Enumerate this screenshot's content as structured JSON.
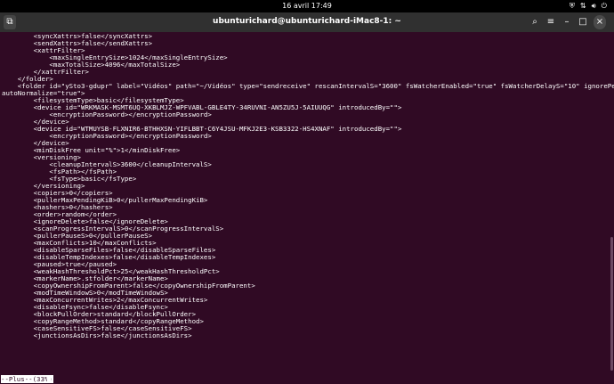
{
  "topbar": {
    "clock": "16 avril  17:49",
    "icons": [
      "shield-icon",
      "network-icon",
      "volume-icon",
      "power-icon"
    ]
  },
  "window": {
    "title": "ubunturichard@ubunturichard-iMac8-1: ~",
    "buttons": [
      "new-tab-icon",
      "search-icon",
      "menu-icon",
      "minimize-icon",
      "maximize-icon",
      "close-icon"
    ]
  },
  "terminal": {
    "lines": [
      "        <syncXattrs>false</syncXattrs>",
      "        <sendXattrs>false</sendXattrs>",
      "        <xattrFilter>",
      "            <maxSingleEntrySize>1024</maxSingleEntrySize>",
      "            <maxTotalSize>4096</maxTotalSize>",
      "        </xattrFilter>",
      "    </folder>",
      "    <folder id=\"ySto3-gdupr\" label=\"Vidéos\" path=\"~/Vidéos\" type=\"sendreceive\" rescanIntervalS=\"3600\" fsWatcherEnabled=\"true\" fsWatcherDelayS=\"10\" ignorePerms=\"false\"",
      "autoNormalize=\"true\">",
      "        <filesystemType>basic</filesystemType>",
      "        <device id=\"WRKMASK-MSMT6UQ-XKBLMJZ-WPFVABL-GBLE4TY-34RUVNI-AN5ZU5J-5AIUUQG\" introducedBy=\"\">",
      "            <encryptionPassword></encryptionPassword>",
      "        </device>",
      "        <device id=\"WTMUYSB-FLXNIR6-BTHHXSN-YIFLBBT-C6Y4JSU-MFKJ2E3-KSB3322-HS4XNAF\" introducedBy=\"\">",
      "            <encryptionPassword></encryptionPassword>",
      "        </device>",
      "        <minDiskFree unit=\"%\">1</minDiskFree>",
      "        <versioning>",
      "            <cleanupIntervalS>3600</cleanupIntervalS>",
      "            <fsPath></fsPath>",
      "            <fsType>basic</fsType>",
      "        </versioning>",
      "        <copiers>0</copiers>",
      "        <pullerMaxPendingKiB>0</pullerMaxPendingKiB>",
      "        <hashers>0</hashers>",
      "        <order>random</order>",
      "        <ignoreDelete>false</ignoreDelete>",
      "        <scanProgressIntervalS>0</scanProgressIntervalS>",
      "        <pullerPauseS>0</pullerPauseS>",
      "        <maxConflicts>10</maxConflicts>",
      "        <disableSparseFiles>false</disableSparseFiles>",
      "        <disableTempIndexes>false</disableTempIndexes>",
      "        <paused>true</paused>",
      "        <weakHashThresholdPct>25</weakHashThresholdPct>",
      "        <markerName>.stfolder</markerName>",
      "        <copyOwnershipFromParent>false</copyOwnershipFromParent>",
      "        <modTimeWindowS>0</modTimeWindowS>",
      "        <maxConcurrentWrites>2</maxConcurrentWrites>",
      "        <disableFsync>false</disableFsync>",
      "        <blockPullOrder>standard</blockPullOrder>",
      "        <copyRangeMethod>standard</copyRangeMethod>",
      "        <caseSensitiveFS>false</caseSensitiveFS>",
      "        <junctionsAsDirs>false</junctionsAsDirs>"
    ],
    "status_line": "--Plus--(33%)"
  },
  "colors": {
    "terminal_bg": "#300a24",
    "titlebar_bg": "#303030",
    "topbar_bg": "#000000",
    "text": "#ffffff"
  }
}
